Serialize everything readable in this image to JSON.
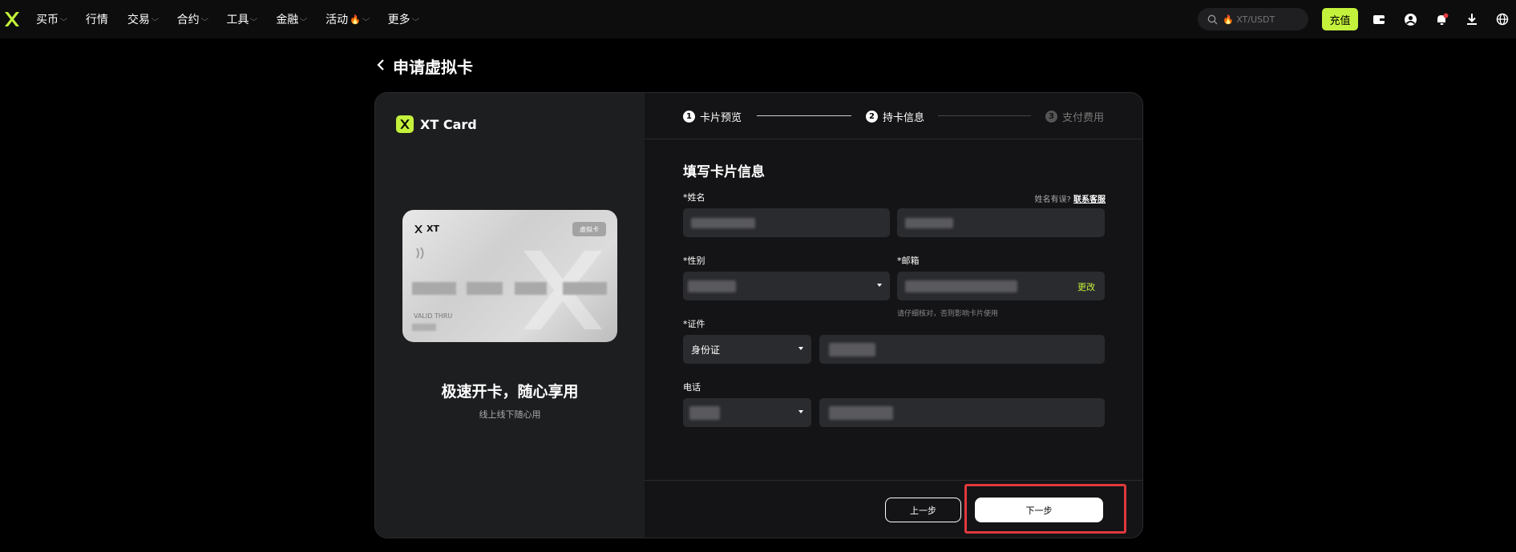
{
  "nav": {
    "items": [
      {
        "label": "买币",
        "chevron": true
      },
      {
        "label": "行情",
        "chevron": false
      },
      {
        "label": "交易",
        "chevron": true
      },
      {
        "label": "合约",
        "chevron": true
      },
      {
        "label": "工具",
        "chevron": true
      },
      {
        "label": "金融",
        "chevron": true
      },
      {
        "label": "活动",
        "chevron": true,
        "fire": true
      },
      {
        "label": "更多",
        "chevron": true
      }
    ],
    "search_placeholder": "🔥 XT/USDT",
    "deposit_label": "充值",
    "icons": [
      "wallet-icon",
      "user-icon",
      "bell-icon",
      "download-icon",
      "globe-icon"
    ],
    "accent": "#c4f13b"
  },
  "page": {
    "title": "申请虚拟卡"
  },
  "left": {
    "brand": "XT Card",
    "card_brand": "XT",
    "card_badge": "虚拟卡",
    "card_valid": "VALID THRU",
    "slogan": "极速开卡，随心享用",
    "sub": "线上线下随心用"
  },
  "steps": [
    {
      "num": "1",
      "label": "卡片预览",
      "active": true
    },
    {
      "num": "2",
      "label": "持卡信息",
      "active": true
    },
    {
      "num": "3",
      "label": "支付费用",
      "active": false
    }
  ],
  "form": {
    "title": "填写卡片信息",
    "name_label": "*姓名",
    "name_hint_prefix": "姓名有误?",
    "name_hint_link": "联系客服",
    "gender_label": "*性别",
    "email_label": "*邮箱",
    "email_change": "更改",
    "email_hint": "请仔细核对，否则影响卡片使用",
    "id_label": "*证件",
    "id_type": "身份证",
    "phone_label": "电话"
  },
  "buttons": {
    "prev": "上一步",
    "next": "下一步"
  },
  "colors": {
    "highlight": "#e0393e"
  }
}
